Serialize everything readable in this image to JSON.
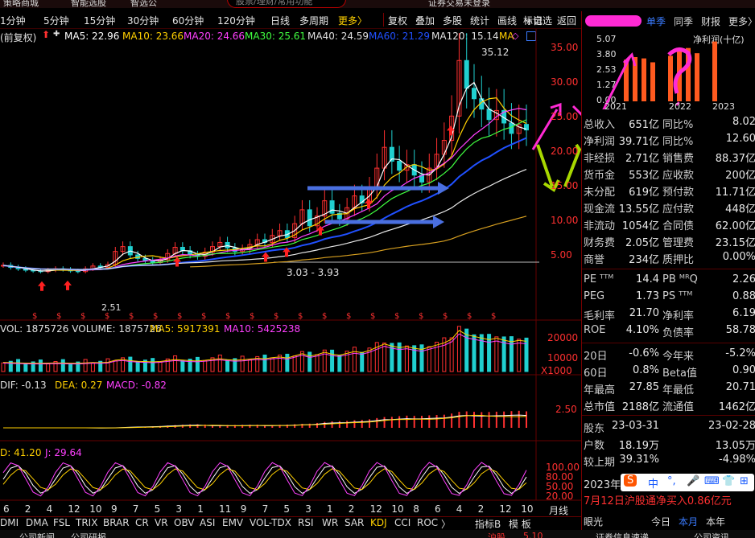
{
  "topbar": {
    "left1": "策略商城",
    "left2": "智能选股",
    "left3": "智选公",
    "center": "证券交易未登录"
  },
  "toolbar": {
    "periods": [
      "1分钟",
      "5分钟",
      "15分钟",
      "30分钟",
      "60分钟",
      "120分钟",
      "日线",
      "多周期"
    ],
    "more": "更多〉",
    "search_placeholder": "股票/理财/常用功能",
    "tools": [
      "复权",
      "叠加",
      "多股",
      "统计",
      "画线",
      "标记",
      "+自选",
      "返回"
    ]
  },
  "legend": {
    "prefix": "(前复权)",
    "ma": [
      {
        "label": "MA5: 22.96",
        "color": "#ffffff"
      },
      {
        "label": "MA10: 23.66",
        "color": "#ffd000"
      },
      {
        "label": "MA20: 24.66",
        "color": "#ff40ff"
      },
      {
        "label": "MA30: 25.61",
        "color": "#40ff40"
      },
      {
        "label": "MA40: 24.59",
        "color": "#e0e0e0"
      },
      {
        "label": "MA60: 21.29",
        "color": "#2050ff"
      },
      {
        "label": "MA120: 15.14",
        "color": "#e0e0e0"
      },
      {
        "label": "MA",
        "color": "#ffd000"
      }
    ]
  },
  "price_axis": [
    "35.00",
    "30.00",
    "25.00",
    "20.00",
    "15.00",
    "10.00",
    "5.00"
  ],
  "price_annotations": {
    "high": "35.12",
    "low": "3.03 - 3.93",
    "low2": "2.51"
  },
  "volume": {
    "header": "VOL: 1875726  VOLUME: 1875726",
    "ma5": "MA5: 5917391",
    "ma10": "MA10: 5425238",
    "axis": [
      "20000",
      "10000",
      "X1000"
    ]
  },
  "macd": {
    "dif": "DIF: -0.13",
    "dea": "DEA: 0.27",
    "macd": "MACD: -0.82",
    "axis": "2.50"
  },
  "kdj": {
    "d": "D: 41.20",
    "j": "J: 29.64",
    "axis": [
      "100.00",
      "80.00",
      "50.00",
      "20.00"
    ]
  },
  "x_axis": {
    "labels": [
      "6",
      "2",
      "4",
      "12",
      "10",
      "9",
      "7",
      "5",
      "3",
      "1",
      "11",
      "9",
      "7",
      "5",
      "3",
      "1",
      "2",
      "12",
      "10",
      "8",
      "6",
      "4",
      "2",
      "12",
      "10"
    ],
    "period": "月线"
  },
  "indicator_tabs": [
    "DMI",
    "DMA",
    "FSL",
    "TRIX",
    "BRAR",
    "CR",
    "VR",
    "OBV",
    "ASI",
    "EMV",
    "VOL-TDX",
    "RSI",
    "WR",
    "SAR",
    "KDJ",
    "CCI",
    "ROC"
  ],
  "indicator_tabs_more": [
    "指标B",
    "模 板"
  ],
  "status_left": [
    "公司新闻",
    "公司研报"
  ],
  "status_right": [
    "沪股",
    "5.10"
  ],
  "side": {
    "tabs": [
      "单季",
      "同季",
      "财报",
      "更多〉"
    ],
    "chart_title": "净利润(十亿)",
    "y_axis": [
      "5.07",
      "3.80",
      "2.53",
      "1.27",
      "0.00"
    ],
    "x_axis": [
      "2021",
      "2022",
      "2023"
    ],
    "bars": [
      3.2,
      3.4,
      3.3,
      3.0,
      0,
      3.5,
      3.9,
      4.1,
      3.7,
      0,
      4.6
    ],
    "rows": [
      {
        "l": "总收入",
        "v": "651亿",
        "l2": "同比%",
        "v2": "8.02"
      },
      {
        "l": "净利润",
        "v": "39.71亿",
        "l2": "同比%",
        "v2": "12.60"
      },
      {
        "l": "非经损",
        "v": "2.71亿",
        "l2": "销售费",
        "v2": "88.37亿"
      },
      {
        "l": "货币金",
        "v": "553亿",
        "l2": "应收款",
        "v2": "200亿"
      },
      {
        "l": "未分配",
        "v": "619亿",
        "l2": "预付款",
        "v2": "11.71亿"
      },
      {
        "l": "现金流",
        "v": "13.55亿",
        "l2": "应付款",
        "v2": "448亿"
      },
      {
        "l": "非流动",
        "v": "1054亿",
        "l2": "合同债",
        "v2": "62.00亿"
      },
      {
        "l": "财务费",
        "v": "2.05亿",
        "l2": "管理费",
        "v2": "23.15亿"
      },
      {
        "l": "商誉",
        "v": "234亿",
        "l2": "质押比",
        "v2": "0.00%"
      }
    ],
    "rows2": [
      {
        "l": "PE ᵀᵀᴹ",
        "v": "14.4",
        "l2": "PB ᴹᴿQ",
        "v2": "2.26"
      },
      {
        "l": "PEG",
        "v": "1.73",
        "l2": "PS ᵀᵀᴹ",
        "v2": "0.88"
      },
      {
        "l": "毛利率",
        "v": "21.70",
        "l2": "净利率",
        "v2": "6.19"
      },
      {
        "l": "ROE",
        "v": "4.10%",
        "l2": "负债率",
        "v2": "58.78"
      }
    ],
    "rows3": [
      {
        "l": "20日",
        "v": "-0.6%",
        "l2": "今年来",
        "v2": "-5.2%"
      },
      {
        "l": "60日",
        "v": "0.8%",
        "l2": "Beta值",
        "v2": "0.90"
      },
      {
        "l": "年最高",
        "v": "27.85",
        "l2": "年最低",
        "v2": "20.71"
      },
      {
        "l": "总市值",
        "v": "2188亿",
        "l2": "流通值",
        "v2": "1462亿"
      }
    ],
    "rows4": [
      {
        "l": "股东",
        "v": "23-03-31",
        "l2": "",
        "v2": "23-02-28"
      },
      {
        "l": "户数",
        "v": "18.19万",
        "l2": "",
        "v2": "13.05万"
      },
      {
        "l": "较上期",
        "v": "39.31%",
        "l2": "",
        "v2": "-4.98%"
      }
    ],
    "year_label": "2023年",
    "notice": "7月12日沪股通净买入0.86亿元",
    "ime": [
      "中",
      "°,",
      "🎤",
      "⌨",
      "👕",
      "⊞"
    ],
    "bottom_tabs": [
      "眼光",
      "今日",
      "本月",
      "本年"
    ],
    "bottom_sub": [
      "证券信息速递",
      "公司资讯"
    ]
  },
  "colors": {
    "up": "#ff3030",
    "down": "#20d0d0",
    "ma_white": "#ffffff",
    "ma_yellow": "#ffd000",
    "ma_magenta": "#ff40ff",
    "ma_green": "#40ff40",
    "ma_blue": "#2050ff",
    "annotation_magenta": "#ff2ad4",
    "annotation_green": "#a8d800",
    "annotation_blue": "#4a6fe0"
  }
}
